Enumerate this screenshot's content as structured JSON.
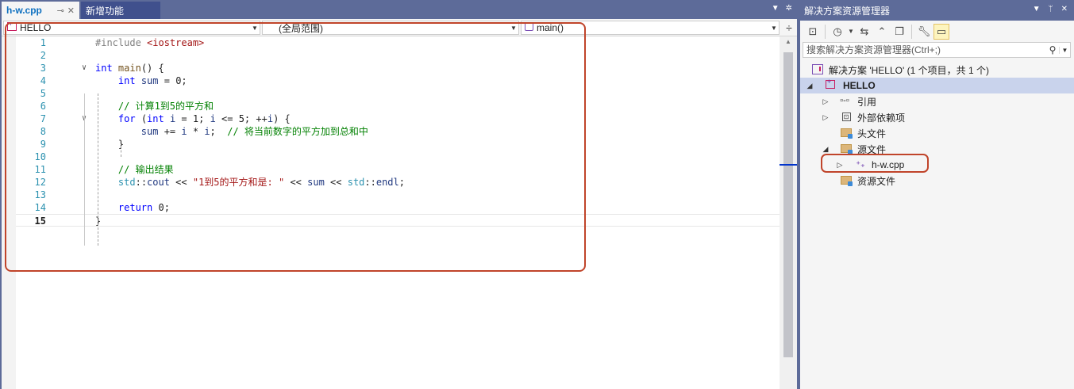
{
  "editor": {
    "tabs": [
      {
        "label": "h-w.cpp",
        "active": true
      },
      {
        "label": "新增功能",
        "active": false
      }
    ],
    "nav": {
      "project": "HELLO",
      "scope": "(全局范围)",
      "member": "main()"
    },
    "lines": [
      {
        "n": "1",
        "fold": "",
        "tokens": [
          {
            "t": "#include ",
            "c": "pp"
          },
          {
            "t": "<iostream>",
            "c": "inc"
          }
        ]
      },
      {
        "n": "2",
        "fold": "",
        "tokens": []
      },
      {
        "n": "3",
        "fold": "∨",
        "tokens": [
          {
            "t": "int",
            "c": "kw"
          },
          {
            "t": " ",
            "c": ""
          },
          {
            "t": "main",
            "c": "fn"
          },
          {
            "t": "() {",
            "c": ""
          }
        ]
      },
      {
        "n": "4",
        "fold": "",
        "tokens": [
          {
            "t": "    ",
            "c": ""
          },
          {
            "t": "int",
            "c": "kw"
          },
          {
            "t": " ",
            "c": ""
          },
          {
            "t": "sum",
            "c": "var"
          },
          {
            "t": " = 0;",
            "c": ""
          }
        ]
      },
      {
        "n": "5",
        "fold": "",
        "tokens": []
      },
      {
        "n": "6",
        "fold": "",
        "tokens": [
          {
            "t": "    ",
            "c": ""
          },
          {
            "t": "// 计算1到5的平方和",
            "c": "cmt"
          }
        ]
      },
      {
        "n": "7",
        "fold": "∨",
        "tokens": [
          {
            "t": "    ",
            "c": ""
          },
          {
            "t": "for",
            "c": "kw"
          },
          {
            "t": " (",
            "c": ""
          },
          {
            "t": "int",
            "c": "kw"
          },
          {
            "t": " ",
            "c": ""
          },
          {
            "t": "i",
            "c": "var"
          },
          {
            "t": " = 1; ",
            "c": ""
          },
          {
            "t": "i",
            "c": "var"
          },
          {
            "t": " <= 5; ++",
            "c": ""
          },
          {
            "t": "i",
            "c": "var"
          },
          {
            "t": ") {",
            "c": ""
          }
        ]
      },
      {
        "n": "8",
        "fold": "",
        "tokens": [
          {
            "t": "        ",
            "c": ""
          },
          {
            "t": "sum",
            "c": "var"
          },
          {
            "t": " += ",
            "c": ""
          },
          {
            "t": "i",
            "c": "var"
          },
          {
            "t": " * ",
            "c": ""
          },
          {
            "t": "i",
            "c": "var"
          },
          {
            "t": ";  ",
            "c": ""
          },
          {
            "t": "// 将当前数字的平方加到总和中",
            "c": "cmt"
          }
        ]
      },
      {
        "n": "9",
        "fold": "",
        "tokens": [
          {
            "t": "    }",
            "c": ""
          }
        ]
      },
      {
        "n": "10",
        "fold": "",
        "tokens": []
      },
      {
        "n": "11",
        "fold": "",
        "tokens": [
          {
            "t": "    ",
            "c": ""
          },
          {
            "t": "// 输出结果",
            "c": "cmt"
          }
        ]
      },
      {
        "n": "12",
        "fold": "",
        "tokens": [
          {
            "t": "    ",
            "c": ""
          },
          {
            "t": "std",
            "c": "ns"
          },
          {
            "t": "::",
            "c": ""
          },
          {
            "t": "cout",
            "c": "var"
          },
          {
            "t": " << ",
            "c": ""
          },
          {
            "t": "\"1到5的平方和是: \"",
            "c": "str"
          },
          {
            "t": " << ",
            "c": ""
          },
          {
            "t": "sum",
            "c": "var"
          },
          {
            "t": " << ",
            "c": ""
          },
          {
            "t": "std",
            "c": "ns"
          },
          {
            "t": "::",
            "c": ""
          },
          {
            "t": "endl",
            "c": "var"
          },
          {
            "t": ";",
            "c": ""
          }
        ]
      },
      {
        "n": "13",
        "fold": "",
        "tokens": []
      },
      {
        "n": "14",
        "fold": "",
        "tokens": [
          {
            "t": "    ",
            "c": ""
          },
          {
            "t": "return",
            "c": "kw"
          },
          {
            "t": " 0;",
            "c": ""
          }
        ]
      },
      {
        "n": "15",
        "fold": "",
        "current": true,
        "tokens": [
          {
            "t": "}",
            "c": ""
          }
        ]
      }
    ]
  },
  "solution_explorer": {
    "title": "解决方案资源管理器",
    "search_placeholder": "搜索解决方案资源管理器(Ctrl+;)",
    "solution_label": "解决方案 'HELLO' (1 个项目，共 1 个)",
    "project_label": "HELLO",
    "items": {
      "references": "引用",
      "external_deps": "外部依赖项",
      "header_files": "头文件",
      "source_files": "源文件",
      "cpp_file": "h-w.cpp",
      "resource_files": "资源文件"
    }
  }
}
